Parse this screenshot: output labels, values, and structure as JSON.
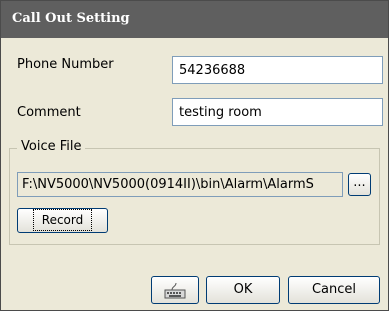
{
  "window": {
    "title": "Call Out Setting"
  },
  "form": {
    "phone_label": "Phone Number",
    "phone_value": "54236688",
    "comment_label": "Comment",
    "comment_value": "testing room"
  },
  "voice_file": {
    "group_label": "Voice File",
    "path": "F:\\NV5000\\NV5000(0914II)\\bin\\Alarm\\AlarmS",
    "browse_label": "...",
    "record_label": "Record"
  },
  "buttons": {
    "keyboard_icon": "keyboard-icon",
    "ok_label": "OK",
    "cancel_label": "Cancel"
  }
}
